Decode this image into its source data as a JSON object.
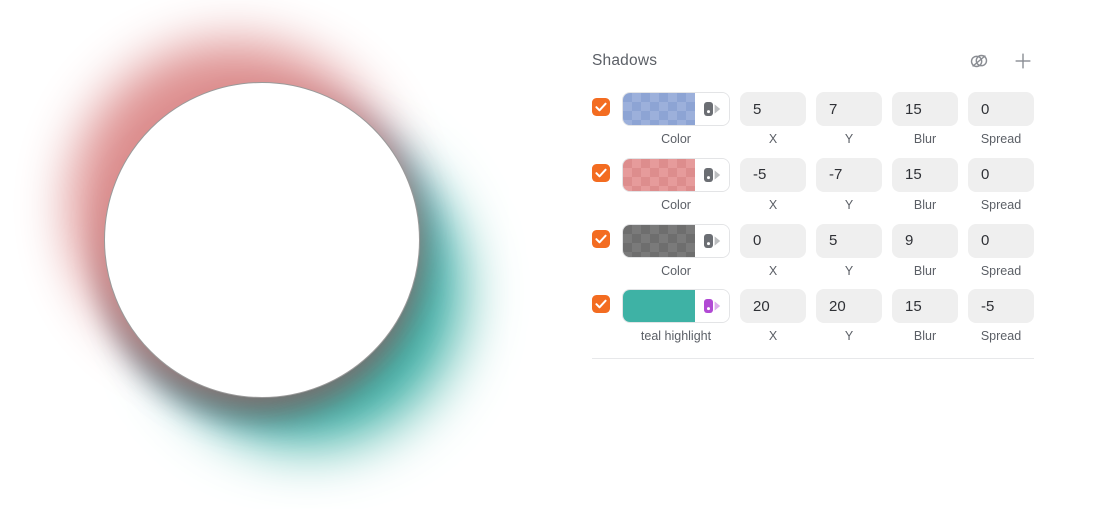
{
  "panel": {
    "title": "Shadows",
    "actions": [
      {
        "name": "blend-mode-icon",
        "label": "Blend mode"
      },
      {
        "name": "plus-icon",
        "label": "Add shadow"
      }
    ],
    "column_labels": {
      "color": "Color",
      "x": "X",
      "y": "Y",
      "blur": "Blur",
      "spread": "Spread"
    },
    "rows": [
      {
        "enabled": true,
        "color_label": "Color",
        "color_hex": "#8da4d4",
        "color_hex_alt": "#9cb0db",
        "transparent": true,
        "variable": false,
        "x": "5",
        "y": "7",
        "blur": "15",
        "spread": "0",
        "x_label": "X",
        "y_label": "Y",
        "blur_label": "Blur",
        "spread_label": "Spread"
      },
      {
        "enabled": true,
        "color_label": "Color",
        "color_hex": "#dd8d8d",
        "color_hex_alt": "#e69b9b",
        "transparent": true,
        "variable": false,
        "x": "-5",
        "y": "-7",
        "blur": "15",
        "spread": "0",
        "x_label": "X",
        "y_label": "Y",
        "blur_label": "Blur",
        "spread_label": "Spread"
      },
      {
        "enabled": true,
        "color_label": "Color",
        "color_hex": "#6e6e6e",
        "color_hex_alt": "#7a7a7a",
        "transparent": true,
        "variable": false,
        "x": "0",
        "y": "5",
        "blur": "9",
        "spread": "0",
        "x_label": "X",
        "y_label": "Y",
        "blur_label": "Blur",
        "spread_label": "Spread"
      },
      {
        "enabled": true,
        "color_label": "teal highlight",
        "color_hex": "#3eb2a5",
        "color_hex_alt": "#3eb2a5",
        "transparent": false,
        "variable": true,
        "x": "20",
        "y": "20",
        "blur": "15",
        "spread": "-5",
        "x_label": "X",
        "y_label": "Y",
        "blur_label": "Blur",
        "spread_label": "Spread"
      }
    ]
  },
  "preview": {
    "shape": "circle",
    "fill_hex": "#ffffff",
    "stroke_hex": "#9a9a9a"
  },
  "theme": {
    "checkbox_on_hex": "#f36c21",
    "variable_icon_hex": "#b14ad4",
    "input_bg_hex": "#efefef",
    "label_hex": "#5b5f66"
  }
}
